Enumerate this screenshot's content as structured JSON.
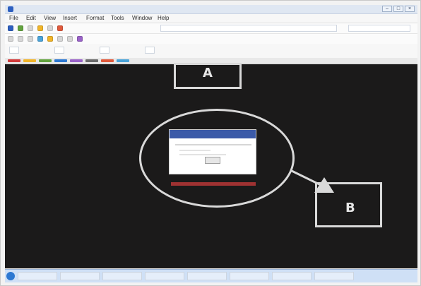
{
  "window": {
    "title": "",
    "controls": [
      "–",
      "□",
      "×"
    ]
  },
  "menu": {
    "items": [
      "File",
      "Edit",
      "View",
      "Insert",
      "Format",
      "Tools",
      "Window",
      "Help"
    ]
  },
  "toolbar": {
    "address_text": "",
    "combo_text": ""
  },
  "ribbon": {
    "buttons": [
      "",
      "",
      "",
      ""
    ]
  },
  "diagram": {
    "callout_a_label": "A",
    "callout_b_label": "B"
  },
  "dialog": {
    "title": "",
    "ok_label": ""
  },
  "taskbar": {
    "items": [
      "",
      "",
      "",
      "",
      "",
      "",
      "",
      ""
    ],
    "time": ""
  },
  "colors": {
    "canvas_bg": "#1b1a1a",
    "annotation_stroke": "#d9d9d9",
    "dialog_header": "#3b5aa8",
    "taskbar_bg": "#cfe0f6",
    "caption_red": "#c13838"
  }
}
